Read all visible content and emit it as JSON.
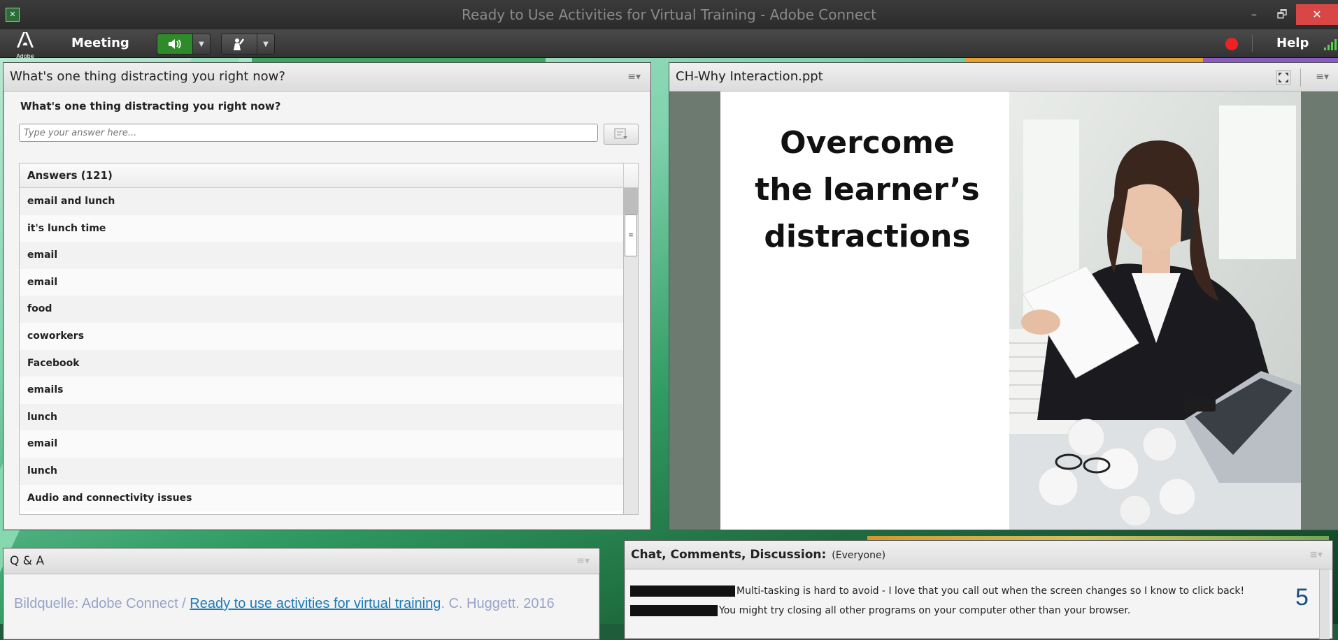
{
  "window": {
    "title": "Ready to Use Activities for Virtual Training - Adobe Connect",
    "controls": [
      "–",
      "🗗",
      "✕"
    ]
  },
  "menubar": {
    "logo_text": "Adobe",
    "meeting_label": "Meeting",
    "help_label": "Help",
    "record_color": "#e22222",
    "speaker_color": "#2f8a2a"
  },
  "question_pod": {
    "header_title": "What's one thing distracting you right now?",
    "question": "What's one thing distracting you right now?",
    "input_placeholder": "Type your answer here...",
    "answers_header": "Answers (121)",
    "answers": [
      "email and lunch",
      "it's lunch time",
      "email",
      "email",
      "food",
      "coworkers",
      "Facebook",
      "emails",
      "lunch",
      "email",
      "lunch",
      "Audio and connectivity issues"
    ]
  },
  "share_pod": {
    "header_title": "CH-Why Interaction.ppt",
    "slide": {
      "title_lines": [
        "Overcome",
        "the learner’s",
        "distractions"
      ]
    }
  },
  "qa_pod": {
    "header_title": "Q & A"
  },
  "chat_pod": {
    "header_title": "Chat, Comments, Discussion:",
    "scope": "(Everyone)",
    "messages": [
      "Multi-tasking is hard to avoid - I love that you call out when the screen changes so I know to click back!",
      "You might try closing all other programs on your computer other than your browser."
    ]
  },
  "overlay": {
    "caption_prefix": "Bildquelle: Adobe Connect / ",
    "caption_link": "Ready to use activities for virtual training",
    "caption_suffix": ". C. Huggett. 2016",
    "slide_number": "5"
  }
}
